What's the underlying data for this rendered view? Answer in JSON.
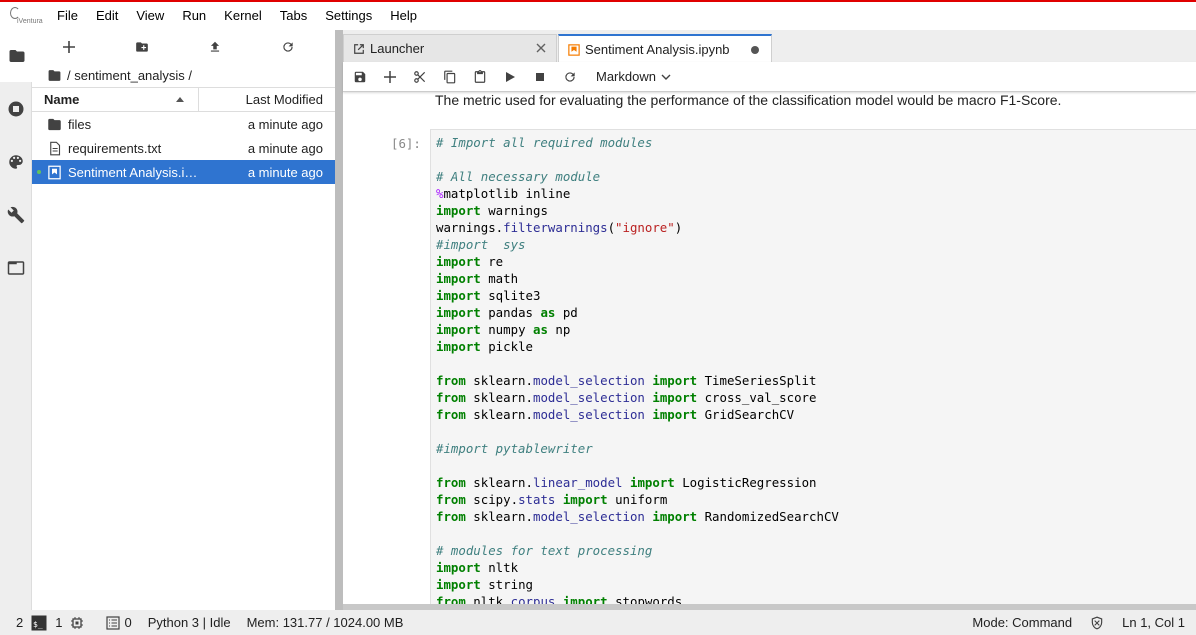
{
  "menu": {
    "logo_text": "iVentura",
    "items": [
      "File",
      "Edit",
      "View",
      "Run",
      "Kernel",
      "Tabs",
      "Settings",
      "Help"
    ]
  },
  "activity": {
    "icons": [
      "folder-icon",
      "running-icon",
      "palette-icon",
      "wrench-icon",
      "tabs-icon"
    ]
  },
  "filebrowser": {
    "breadcrumb": "/ sentiment_analysis /",
    "header_name": "Name",
    "header_modified": "Last Modified",
    "files": [
      {
        "name": "files",
        "modified": "a minute ago",
        "icon": "folder-icon",
        "selected": false
      },
      {
        "name": "requirements.txt",
        "modified": "a minute ago",
        "icon": "file-icon",
        "selected": false
      },
      {
        "name": "Sentiment Analysis.ipynb",
        "modified": "a minute ago",
        "icon": "notebook-icon",
        "selected": true
      }
    ]
  },
  "tabs": [
    {
      "label": "Launcher",
      "icon": "launcher-icon",
      "active": false
    },
    {
      "label": "Sentiment Analysis.ipynb",
      "icon": "notebook-icon",
      "active": true
    }
  ],
  "notebook": {
    "cell_type": "Markdown",
    "markdown_text": "The metric used for evaluating the performance of the classification model would be macro F1-Score.",
    "prompt": "[6]:"
  },
  "status": {
    "terminals": "2",
    "kernels": "1",
    "log_count": "0",
    "kernel": "Python 3 | Idle",
    "memory": "Mem: 131.77 / 1024.00 MB",
    "mode": "Mode: Command",
    "cursor": "Ln 1, Col 1"
  },
  "colors": {
    "accent": "#2f74d0",
    "top_line": "#e00000",
    "notebook_icon": "#f57c00"
  }
}
